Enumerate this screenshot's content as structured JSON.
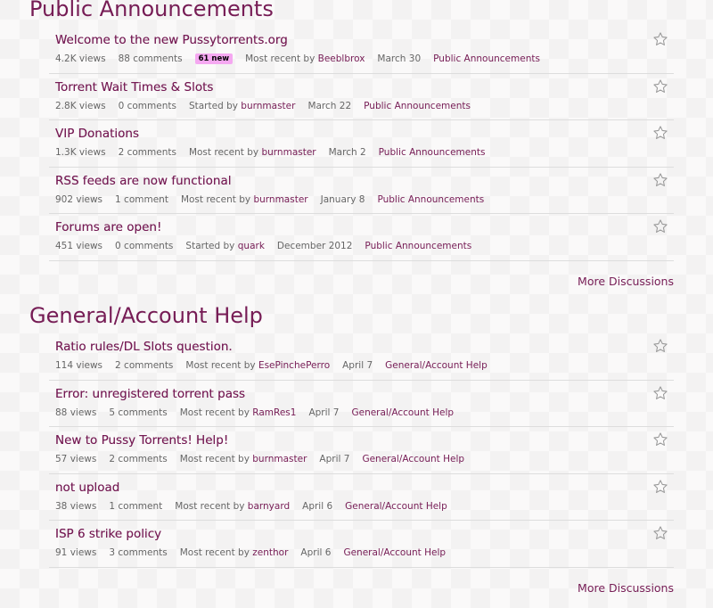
{
  "categories": [
    {
      "title": "Public Announcements",
      "more_label": "More Discussions",
      "discussions": [
        {
          "title": "Welcome to the new Pussytorrents.org",
          "views": "4.2K views",
          "comments": "88 comments",
          "badge": "61 new",
          "by_label": "Most recent by",
          "user": "Beeblbrox",
          "date": "March 30",
          "category": "Public Announcements"
        },
        {
          "title": "Torrent Wait Times & Slots",
          "views": "2.8K views",
          "comments": "0 comments",
          "badge": "",
          "by_label": "Started by",
          "user": "burnmaster",
          "date": "March 22",
          "category": "Public Announcements"
        },
        {
          "title": "VIP Donations",
          "views": "1.3K views",
          "comments": "2 comments",
          "badge": "",
          "by_label": "Most recent by",
          "user": "burnmaster",
          "date": "March 2",
          "category": "Public Announcements"
        },
        {
          "title": "RSS feeds are now functional",
          "views": "902 views",
          "comments": "1 comment",
          "badge": "",
          "by_label": "Most recent by",
          "user": "burnmaster",
          "date": "January 8",
          "category": "Public Announcements"
        },
        {
          "title": "Forums are open!",
          "views": "451 views",
          "comments": "0 comments",
          "badge": "",
          "by_label": "Started by",
          "user": "quark",
          "date": "December 2012",
          "category": "Public Announcements"
        }
      ]
    },
    {
      "title": "General/Account Help",
      "more_label": "More Discussions",
      "discussions": [
        {
          "title": "Ratio rules/DL Slots question.",
          "views": "114 views",
          "comments": "2 comments",
          "badge": "",
          "by_label": "Most recent by",
          "user": "EsePinchePerro",
          "date": "April 7",
          "category": "General/Account Help"
        },
        {
          "title": "Error: unregistered torrent pass",
          "views": "88 views",
          "comments": "5 comments",
          "badge": "",
          "by_label": "Most recent by",
          "user": "RamRes1",
          "date": "April 7",
          "category": "General/Account Help"
        },
        {
          "title": "New to Pussy Torrents! Help!",
          "views": "57 views",
          "comments": "2 comments",
          "badge": "",
          "by_label": "Most recent by",
          "user": "burnmaster",
          "date": "April 7",
          "category": "General/Account Help"
        },
        {
          "title": "not upload",
          "views": "38 views",
          "comments": "1 comment",
          "badge": "",
          "by_label": "Most recent by",
          "user": "barnyard",
          "date": "April 6",
          "category": "General/Account Help"
        },
        {
          "title": "ISP 6 strike policy",
          "views": "91 views",
          "comments": "3 comments",
          "badge": "",
          "by_label": "Most recent by",
          "user": "zenthor",
          "date": "April 6",
          "category": "General/Account Help"
        }
      ]
    }
  ],
  "icons": {
    "bookmark": "star-outline-icon"
  },
  "colors": {
    "accent": "#761c55",
    "badge_bg": "#f5a8f1",
    "divider": "#dddddd"
  }
}
